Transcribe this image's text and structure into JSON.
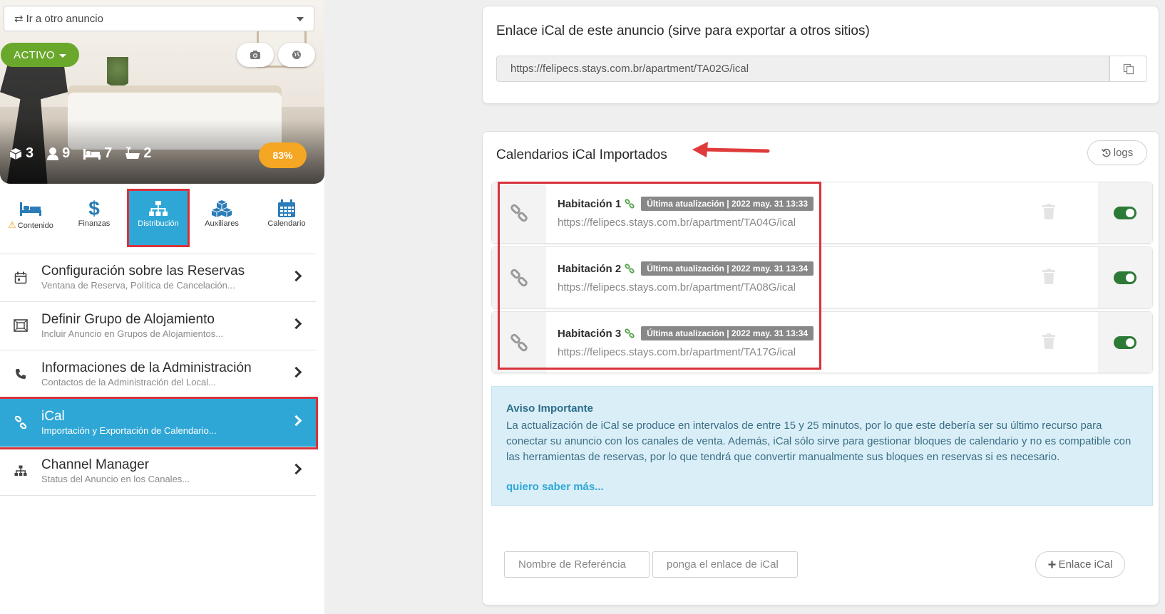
{
  "listing_select": {
    "label": "Ir a otro anuncio"
  },
  "status": {
    "label": "ACTIVO"
  },
  "hero": {
    "stats": [
      {
        "icon": "cube-icon",
        "value": "3"
      },
      {
        "icon": "user-icon",
        "value": "9"
      },
      {
        "icon": "bed-icon",
        "value": "7"
      },
      {
        "icon": "bath-icon",
        "value": "2"
      }
    ],
    "progress": "83%"
  },
  "tabs": [
    {
      "label": "Contenido",
      "icon": "bed-icon",
      "warning": true
    },
    {
      "label": "Finanzas",
      "icon": "dollar-icon"
    },
    {
      "label": "Distribución",
      "icon": "sitemap-icon",
      "active": true
    },
    {
      "label": "Auxiliares",
      "icon": "cubes-icon"
    },
    {
      "label": "Calendario",
      "icon": "calendar-icon"
    }
  ],
  "menu": [
    {
      "title": "Configuración sobre las Reservas",
      "subtitle": "Ventana de Reserva, Política de Cancelación...",
      "icon": "calendar-icon"
    },
    {
      "title": "Definir Grupo de Alojamiento",
      "subtitle": "Incluir Anuncio en Grupos de Alojamientos...",
      "icon": "group-icon"
    },
    {
      "title": "Informaciones de la Administración",
      "subtitle": "Contactos de la Administración del Local...",
      "icon": "phone-icon"
    },
    {
      "title": "iCal",
      "subtitle": "Importación y Exportación de Calendario...",
      "icon": "link-icon",
      "active": true
    },
    {
      "title": "Channel Manager",
      "subtitle": "Status del Anuncio en los Canales...",
      "icon": "sitemap-icon"
    }
  ],
  "export": {
    "title": "Enlace iCal de este anuncio (sirve para exportar a otros sitios)",
    "url": "https://felipecs.stays.com.br/apartment/TA02G/ical"
  },
  "imported": {
    "title": "Calendarios iCal Importados",
    "logs_label": "logs",
    "calendars": [
      {
        "name": "Habitación 1",
        "badge": "Última atualización | 2022 may. 31 13:33",
        "url": "https://felipecs.stays.com.br/apartment/TA04G/ical",
        "enabled": true
      },
      {
        "name": "Habitación 2",
        "badge": "Última atualización | 2022 may. 31 13:34",
        "url": "https://felipecs.stays.com.br/apartment/TA08G/ical",
        "enabled": true
      },
      {
        "name": "Habitación 3",
        "badge": "Última atualización | 2022 may. 31 13:34",
        "url": "https://felipecs.stays.com.br/apartment/TA17G/ical",
        "enabled": true
      }
    ]
  },
  "notice": {
    "title": "Aviso Importante",
    "text": "La actualización de iCal se produce en intervalos de entre 15 y 25 minutos, por lo que este debería ser su último recurso para conectar su anuncio con los canales de venta. Además, iCal sólo sirve para gestionar bloques de calendario y no es compatible con las herramientas de reservas, por lo que tendrá que convertir manualmente sus bloques en reservas si es necesario.",
    "link": "quiero saber más..."
  },
  "add_form": {
    "name_placeholder": "Nombre de Referéncia",
    "link_placeholder": "ponga el enlace de iCal",
    "add_label": "Enlace iCal"
  },
  "colors": {
    "accent": "#2fa7d6",
    "active_green": "#6aa82b",
    "toggle_green": "#2c7a36",
    "highlight_red": "#d8323b",
    "badge_orange": "#f5a623"
  }
}
